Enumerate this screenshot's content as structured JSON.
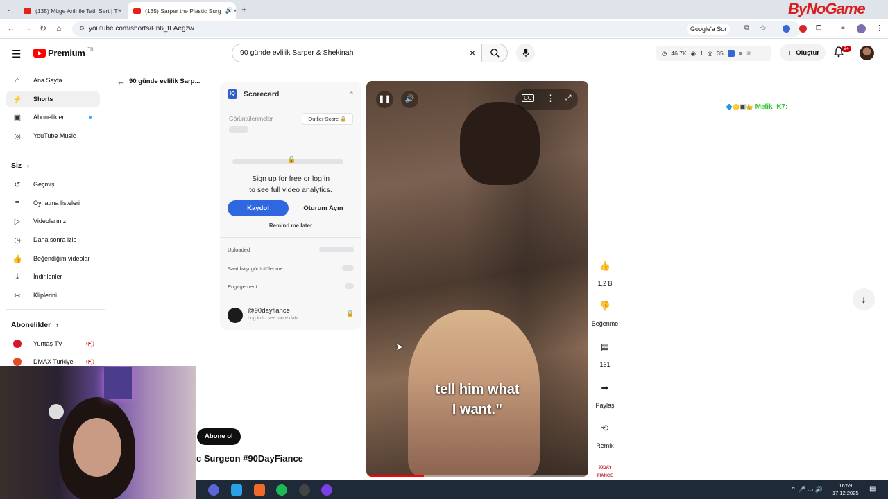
{
  "tabs": [
    {
      "title": "(135) Müge Anlı ile Tatlı Sert | T"
    },
    {
      "title": "(135) Sarper the Plastic Surg"
    }
  ],
  "browser": {
    "url": "youtube.com/shorts/Pn6_tLAegzw",
    "google_ask": "Google'a Sor",
    "watermark": "ByNoGame"
  },
  "header": {
    "brand": "Premium",
    "brand_region": "TR",
    "search_value": "90 günde evlilik Sarper & Shekinah",
    "stats": {
      "likes": "46.7K",
      "views": "1",
      "watching": "35"
    },
    "create_label": "Oluştur",
    "notif_badge": "9+"
  },
  "sidebar": {
    "main": [
      {
        "label": "Ana Sayfa",
        "icon": "home-icon"
      },
      {
        "label": "Shorts",
        "icon": "shorts-icon"
      },
      {
        "label": "Abonelikler",
        "icon": "subscriptions-icon"
      },
      {
        "label": "YouTube Music",
        "icon": "music-icon"
      }
    ],
    "you_heading": "Siz",
    "you": [
      {
        "label": "Geçmiş",
        "icon": "history-icon"
      },
      {
        "label": "Oynatma listeleri",
        "icon": "playlist-icon"
      },
      {
        "label": "Videolarınız",
        "icon": "your-videos-icon"
      },
      {
        "label": "Daha sonra izle",
        "icon": "clock-icon"
      },
      {
        "label": "Beğendiğim videolar",
        "icon": "like-icon"
      },
      {
        "label": "İndirilenler",
        "icon": "download-icon"
      },
      {
        "label": "Kliplerini",
        "icon": "scissors-icon"
      }
    ],
    "subs_heading": "Abonelikler",
    "subs": [
      {
        "label": "Yurttaş TV",
        "color": "#d3182a"
      },
      {
        "label": "DMAX Turkiye",
        "color": "#e44b2a"
      }
    ]
  },
  "back": {
    "title": "90 günde evlilik Sarp..."
  },
  "scorecard": {
    "title": "Scorecard",
    "views_label": "Görüntülenmeler",
    "outlier_label": "Outlier Score",
    "signup_text_1": "Sign up for",
    "signup_free": "free",
    "signup_text_2": "or log in",
    "signup_text_3": "to see full video analytics.",
    "signup_button": "Kaydol",
    "login_button": "Oturum Açın",
    "remind": "Remind me later",
    "rows": [
      {
        "label": "Uploaded"
      },
      {
        "label": "Saat başı görüntülenme"
      },
      {
        "label": "Engagement"
      }
    ],
    "channel": "@90dayfiance",
    "channel_sub": "Log in to see more data"
  },
  "video": {
    "subtitle_line1": "tell him what",
    "subtitle_line2": "I want.”",
    "progress": 0.26,
    "subscribe": "Abone ol",
    "title_fragment": "c Surgeon #90DayFiance",
    "brand_mark": "90DAY FIANCÉ"
  },
  "actions": [
    {
      "label": "1,2 B",
      "icon": "thumbs-up-icon"
    },
    {
      "label": "Beğenme",
      "icon": "thumbs-down-icon"
    },
    {
      "label": "161",
      "icon": "comment-icon"
    },
    {
      "label": "Paylaş",
      "icon": "share-icon"
    },
    {
      "label": "Remix",
      "icon": "remix-icon"
    }
  ],
  "chat": {
    "username": "Melik_K7:"
  },
  "taskbar": {
    "time": "16:59",
    "date": "17.12.2025"
  }
}
